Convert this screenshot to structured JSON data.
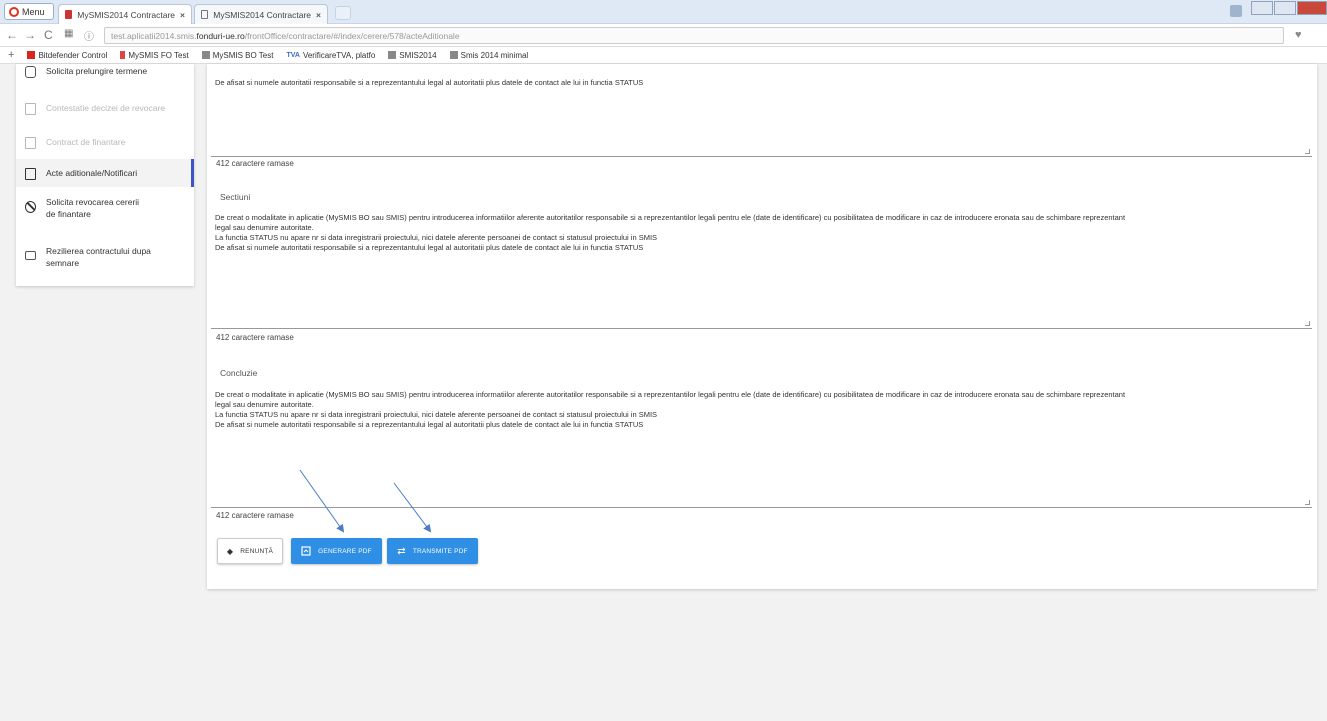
{
  "browser": {
    "menu_label": "Menu",
    "tabs": [
      {
        "title": "MySMIS2014 Contractare",
        "active": true
      },
      {
        "title": "MySMIS2014 Contractare",
        "active": false
      }
    ],
    "url_prefix": "test.aplicatii2014.smis.",
    "url_host": "fonduri-ue.ro",
    "url_path": "/frontOffice/contractare/#/index/cerere/578/acteAditionale",
    "bookmarks": [
      {
        "label": "Bitdefender Control",
        "icon": "bitdefender-icon"
      },
      {
        "label": "MySMIS FO Test",
        "icon": "smis-icon"
      },
      {
        "label": "MySMIS BO Test",
        "icon": "page-icon"
      },
      {
        "label": "VerificareTVA, platfo",
        "icon": "tva-icon"
      },
      {
        "label": "SMIS2014",
        "icon": "page-icon"
      },
      {
        "label": "Smis 2014 minimal",
        "icon": "page-icon"
      }
    ]
  },
  "sidebar": {
    "items": [
      {
        "label": "Solicita prelungire termene",
        "icon": "clock-icon",
        "state": "normal"
      },
      {
        "label": "Contestatie decizei de revocare",
        "icon": "document-icon",
        "state": "disabled"
      },
      {
        "label": "Contract de finantare",
        "icon": "document-icon",
        "state": "disabled"
      },
      {
        "label": "Acte aditionale/Notificari",
        "icon": "document-icon",
        "state": "active"
      },
      {
        "label": "Solicita revocarea cererii de finantare",
        "icon": "ban-icon",
        "state": "normal"
      },
      {
        "label": "Rezilierea contractului dupa semnare",
        "icon": "money-icon",
        "state": "normal"
      }
    ]
  },
  "form": {
    "top_text_line": "De afisat si numele autoritatii responsabile si a reprezentantului legal al autoritatii plus datele de contact ale lui in functia STATUS",
    "counter_label": "412 caractere ramase",
    "sections": [
      {
        "label": "Sectiuni",
        "lines": [
          "De creat o modalitate in aplicatie (MySMIS BO sau SMIS) pentru introducerea informatiilor aferente autoritatilor responsabile si a reprezentantilor legali pentru ele (date de identificare) cu posibilitatea de modificare in caz de introducere eronata sau de schimbare reprezentant",
          "legal sau denumire autoritate.",
          "La functia STATUS nu apare nr si data inregistrarii proiectului, nici datele aferente persoanei de contact si statusul proiectului in SMIS",
          "De afisat si numele autoritatii responsabile si a reprezentantului legal al autoritatii plus datele de contact ale lui in functia STATUS"
        ]
      },
      {
        "label": "Concluzie",
        "lines": [
          "De creat o modalitate in aplicatie (MySMIS BO sau SMIS) pentru introducerea informatiilor aferente autoritatilor responsabile si a reprezentantilor legali pentru ele (date de identificare) cu posibilitatea de modificare in caz de introducere eronata sau de schimbare reprezentant",
          "legal sau denumire autoritate.",
          "La functia STATUS nu apare nr si data inregistrarii proiectului, nici datele aferente persoanei de contact si statusul proiectului in SMIS",
          "De afisat si numele autoritatii responsabile si a reprezentantului legal al autoritatii plus datele de contact ale lui in functia STATUS"
        ]
      }
    ],
    "buttons": {
      "cancel": "RENUNȚĂ",
      "generate_pdf": "GENERARE PDF",
      "send_pdf": "TRANSMITE PDF"
    }
  },
  "colors": {
    "primary": "#2f8fe4",
    "active_indicator": "#3b56c4",
    "annotation_arrow": "#4a7ec2"
  }
}
